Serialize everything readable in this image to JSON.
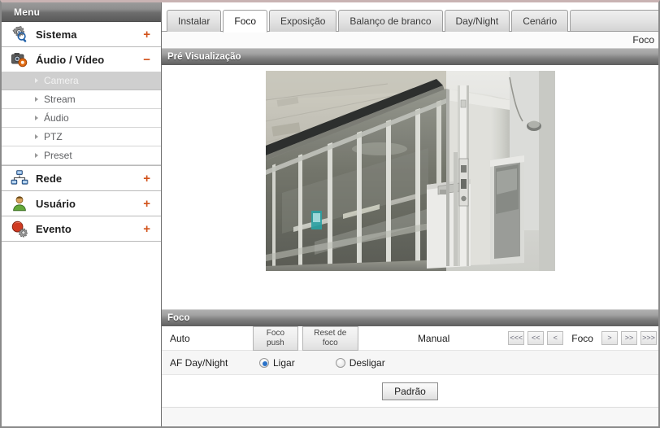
{
  "sidebar": {
    "header": "Menu",
    "groups": [
      {
        "label": "Sistema",
        "icon": "system-gear-icon",
        "toggle": "+",
        "expanded": false,
        "children": []
      },
      {
        "label": "Áudio / Vídeo",
        "icon": "camera-icon",
        "toggle": "−",
        "expanded": true,
        "children": [
          {
            "label": "Camera",
            "active": true
          },
          {
            "label": "Stream",
            "active": false
          },
          {
            "label": "Áudio",
            "active": false
          },
          {
            "label": "PTZ",
            "active": false
          },
          {
            "label": "Preset",
            "active": false
          }
        ]
      },
      {
        "label": "Rede",
        "icon": "network-icon",
        "toggle": "+",
        "expanded": false,
        "children": []
      },
      {
        "label": "Usuário",
        "icon": "user-icon",
        "toggle": "+",
        "expanded": false,
        "children": []
      },
      {
        "label": "Evento",
        "icon": "event-alarm-icon",
        "toggle": "+",
        "expanded": false,
        "children": []
      }
    ]
  },
  "tabs": [
    {
      "label": "Instalar",
      "active": false
    },
    {
      "label": "Foco",
      "active": true
    },
    {
      "label": "Exposição",
      "active": false
    },
    {
      "label": "Balanço de branco",
      "active": false
    },
    {
      "label": "Day/Night",
      "active": false
    },
    {
      "label": "Cenário",
      "active": false
    }
  ],
  "breadcrumb": "Foco",
  "preview": {
    "section_title": "Pré Visualização",
    "image_alt": "camera live preview: corridor with glass partition wall and white door"
  },
  "focus": {
    "section_title": "Foco",
    "auto_label": "Auto",
    "buttons": {
      "foco_push": "Foco push",
      "reset_foco": "Reset de foco"
    },
    "manual_label": "Manual",
    "arrows": {
      "left3": "<<<",
      "left2": "<<",
      "left1": "<",
      "center": "Foco",
      "right1": ">",
      "right2": ">>",
      "right3": ">>>"
    },
    "af_label": "AF Day/Night",
    "af_options": [
      {
        "label": "Ligar",
        "selected": true
      },
      {
        "label": "Desligar",
        "selected": false
      }
    ],
    "default_button": "Padrão"
  },
  "colors": {
    "accent_orange": "#d2521a",
    "radio_blue": "#2a72c8",
    "header_gray": "#6d6d6d",
    "active_sub_bg": "#cfcfcf"
  }
}
